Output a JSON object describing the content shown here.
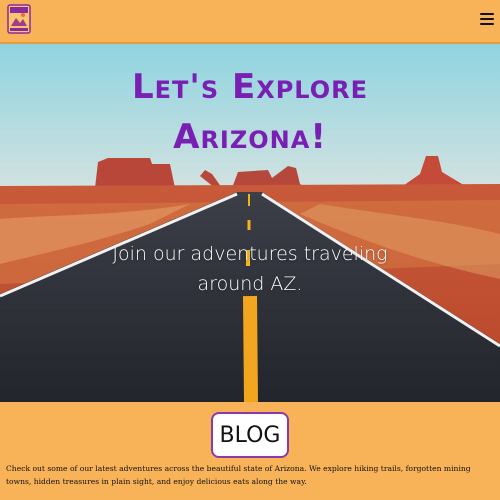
{
  "header": {
    "logo_icon": "arizona-logo-icon",
    "menu_icon": "hamburger-menu-icon"
  },
  "hero": {
    "title_line1": "Let's Explore",
    "title_line2": "Arizona!",
    "subtitle_line1": "Join our adventures traveling",
    "subtitle_line2": "around AZ."
  },
  "blog": {
    "button_label": "BLOG",
    "description": "Check out some of our latest adventures across the beautiful state of Arizona. We explore hiking trails, forgotten mining towns, hidden treasures in plain sight, and enjoy delicious eats along the way."
  },
  "colors": {
    "brand_orange": "#f8b257",
    "title_purple": "#7a1fb3",
    "button_border": "#8a3aa8"
  }
}
